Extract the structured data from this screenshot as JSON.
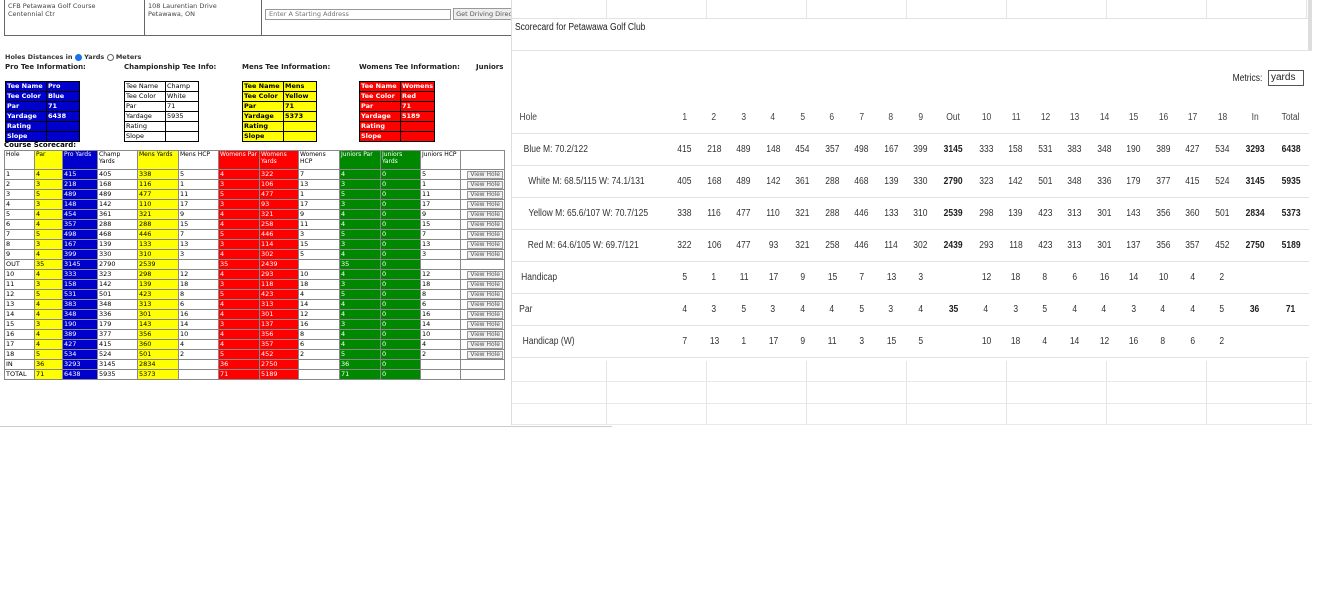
{
  "left": {
    "header": {
      "course_name": "CFB Petawawa Golf Course",
      "course_sub": "Centennial Ctr",
      "address_line1": "108 Laurentian Drive",
      "address_line2": "Petawawa, ON",
      "address_placeholder": "Enter A Starting Address",
      "directions_button": "Get Driving Directi"
    },
    "units": {
      "label": "Holes Distances in",
      "yards": "Yards",
      "meters": "Meters"
    },
    "tee_headers": {
      "pro": "Pro Tee Information:",
      "champ": "Championship Tee Info:",
      "mens": "Mens Tee Information:",
      "womens": "Womens Tee Information:",
      "juniors": "Juniors"
    },
    "tee_labels": [
      "Tee Name",
      "Tee Color",
      "Par",
      "Yardage",
      "Rating",
      "Slope"
    ],
    "tee_values": {
      "pro": [
        "Pro",
        "Blue",
        "71",
        "6438",
        "",
        ""
      ],
      "champ": [
        "Champ",
        "White",
        "71",
        "5935",
        "",
        ""
      ],
      "mens": [
        "Mens",
        "Yellow",
        "71",
        "5373",
        "",
        ""
      ],
      "womens": [
        "Womens",
        "Red",
        "71",
        "5189",
        "",
        ""
      ]
    },
    "scorecard_title": "Course Scorecard:",
    "scorecard_headers": [
      "Hole",
      "Par",
      "Pro Yards",
      "Champ Yards",
      "Mens Yards",
      "Mens HCP",
      "Womens Par",
      "Womens Yards",
      "Womens HCP",
      "Juniors Par",
      "Juniors Yards",
      "Juniors HCP"
    ],
    "view_hole_label": "View Hole",
    "scorecard_rows": [
      [
        "1",
        "4",
        "415",
        "405",
        "338",
        "5",
        "4",
        "322",
        "7",
        "4",
        "0",
        "5"
      ],
      [
        "2",
        "3",
        "218",
        "168",
        "116",
        "1",
        "3",
        "106",
        "13",
        "3",
        "0",
        "1"
      ],
      [
        "3",
        "5",
        "489",
        "489",
        "477",
        "11",
        "5",
        "477",
        "1",
        "5",
        "0",
        "11"
      ],
      [
        "4",
        "3",
        "148",
        "142",
        "110",
        "17",
        "3",
        "93",
        "17",
        "3",
        "0",
        "17"
      ],
      [
        "5",
        "4",
        "454",
        "361",
        "321",
        "9",
        "4",
        "321",
        "9",
        "4",
        "0",
        "9"
      ],
      [
        "6",
        "4",
        "357",
        "288",
        "288",
        "15",
        "4",
        "258",
        "11",
        "4",
        "0",
        "15"
      ],
      [
        "7",
        "5",
        "498",
        "468",
        "446",
        "7",
        "5",
        "446",
        "3",
        "5",
        "0",
        "7"
      ],
      [
        "8",
        "3",
        "167",
        "139",
        "133",
        "13",
        "3",
        "114",
        "15",
        "3",
        "0",
        "13"
      ],
      [
        "9",
        "4",
        "399",
        "330",
        "310",
        "3",
        "4",
        "302",
        "5",
        "4",
        "0",
        "3"
      ],
      [
        "OUT",
        "35",
        "3145",
        "2790",
        "2539",
        "",
        "35",
        "2439",
        "",
        "35",
        "0",
        ""
      ],
      [
        "10",
        "4",
        "333",
        "323",
        "298",
        "12",
        "4",
        "293",
        "10",
        "4",
        "0",
        "12"
      ],
      [
        "11",
        "3",
        "158",
        "142",
        "139",
        "18",
        "3",
        "118",
        "18",
        "3",
        "0",
        "18"
      ],
      [
        "12",
        "5",
        "531",
        "501",
        "423",
        "8",
        "5",
        "423",
        "4",
        "5",
        "0",
        "8"
      ],
      [
        "13",
        "4",
        "383",
        "348",
        "313",
        "6",
        "4",
        "313",
        "14",
        "4",
        "0",
        "6"
      ],
      [
        "14",
        "4",
        "348",
        "336",
        "301",
        "16",
        "4",
        "301",
        "12",
        "4",
        "0",
        "16"
      ],
      [
        "15",
        "3",
        "190",
        "179",
        "143",
        "14",
        "3",
        "137",
        "16",
        "3",
        "0",
        "14"
      ],
      [
        "16",
        "4",
        "389",
        "377",
        "356",
        "10",
        "4",
        "356",
        "8",
        "4",
        "0",
        "10"
      ],
      [
        "17",
        "4",
        "427",
        "415",
        "360",
        "4",
        "4",
        "357",
        "6",
        "4",
        "0",
        "4"
      ],
      [
        "18",
        "5",
        "534",
        "524",
        "501",
        "2",
        "5",
        "452",
        "2",
        "5",
        "0",
        "2"
      ],
      [
        "IN",
        "36",
        "3293",
        "3145",
        "2834",
        "",
        "36",
        "2750",
        "",
        "36",
        "0",
        ""
      ],
      [
        "TOTAL",
        "71",
        "6438",
        "5935",
        "5373",
        "",
        "71",
        "5189",
        "",
        "71",
        "0",
        ""
      ]
    ]
  },
  "right": {
    "title": "Scorecard for Petawawa Golf Club",
    "metrics_label": "Metrics:",
    "metrics_value": "yards",
    "columns": [
      "Hole",
      "1",
      "2",
      "3",
      "4",
      "5",
      "6",
      "7",
      "8",
      "9",
      "Out",
      "10",
      "11",
      "12",
      "13",
      "14",
      "15",
      "16",
      "17",
      "18",
      "In",
      "Total"
    ],
    "rows": [
      {
        "label": "Blue M: 70.2/122",
        "values": [
          "415",
          "218",
          "489",
          "148",
          "454",
          "357",
          "498",
          "167",
          "399",
          "3145",
          "333",
          "158",
          "531",
          "383",
          "348",
          "190",
          "389",
          "427",
          "534",
          "3293",
          "6438"
        ]
      },
      {
        "label": "White M: 68.5/115 W: 74.1/131",
        "values": [
          "405",
          "168",
          "489",
          "142",
          "361",
          "288",
          "468",
          "139",
          "330",
          "2790",
          "323",
          "142",
          "501",
          "348",
          "336",
          "179",
          "377",
          "415",
          "524",
          "3145",
          "5935"
        ]
      },
      {
        "label": "Yellow M: 65.6/107 W: 70.7/125",
        "values": [
          "338",
          "116",
          "477",
          "110",
          "321",
          "288",
          "446",
          "133",
          "310",
          "2539",
          "298",
          "139",
          "423",
          "313",
          "301",
          "143",
          "356",
          "360",
          "501",
          "2834",
          "5373"
        ]
      },
      {
        "label": "Red M: 64.6/105 W: 69.7/121",
        "values": [
          "322",
          "106",
          "477",
          "93",
          "321",
          "258",
          "446",
          "114",
          "302",
          "2439",
          "293",
          "118",
          "423",
          "313",
          "301",
          "137",
          "356",
          "357",
          "452",
          "2750",
          "5189"
        ]
      },
      {
        "label": "Handicap",
        "values": [
          "5",
          "1",
          "11",
          "17",
          "9",
          "15",
          "7",
          "13",
          "3",
          "",
          "12",
          "18",
          "8",
          "6",
          "16",
          "14",
          "10",
          "4",
          "2",
          "",
          ""
        ]
      },
      {
        "label": "Par",
        "values": [
          "4",
          "3",
          "5",
          "3",
          "4",
          "4",
          "5",
          "3",
          "4",
          "35",
          "4",
          "3",
          "5",
          "4",
          "4",
          "3",
          "4",
          "4",
          "5",
          "36",
          "71"
        ]
      },
      {
        "label": "Handicap (W)",
        "values": [
          "7",
          "13",
          "1",
          "17",
          "9",
          "11",
          "3",
          "15",
          "5",
          "",
          "10",
          "18",
          "4",
          "14",
          "12",
          "16",
          "8",
          "6",
          "2",
          "",
          ""
        ]
      }
    ]
  }
}
